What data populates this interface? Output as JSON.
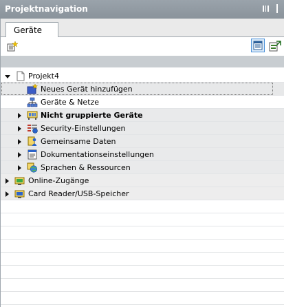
{
  "window": {
    "title": "Projektnavigation"
  },
  "tabs": [
    {
      "label": "Geräte"
    }
  ],
  "toolbar": {
    "left_icon": "add-device-icon",
    "right_icons": [
      "details-view-icon",
      "export-icon"
    ]
  },
  "tree": {
    "project": "Projekt4",
    "items": [
      {
        "label": "Neues Gerät hinzufügen",
        "icon": "add-device-icon"
      },
      {
        "label": "Geräte & Netze",
        "icon": "network-icon"
      },
      {
        "label": "Nicht gruppierte Geräte",
        "icon": "ungrouped-devices-icon",
        "bold": true
      },
      {
        "label": "Security-Einstellungen",
        "icon": "security-icon"
      },
      {
        "label": "Gemeinsame Daten",
        "icon": "common-data-icon"
      },
      {
        "label": "Dokumentationseinstellungen",
        "icon": "documentation-icon"
      },
      {
        "label": "Sprachen & Ressourcen",
        "icon": "languages-icon"
      }
    ],
    "roots": [
      {
        "label": "Online-Zugänge",
        "icon": "online-access-icon"
      },
      {
        "label": "Card Reader/USB-Speicher",
        "icon": "card-reader-icon"
      }
    ]
  },
  "colors": {
    "titlebar": "#8f989f",
    "selection_bg": "#e7e8e9",
    "accent": "#4a90d9"
  }
}
